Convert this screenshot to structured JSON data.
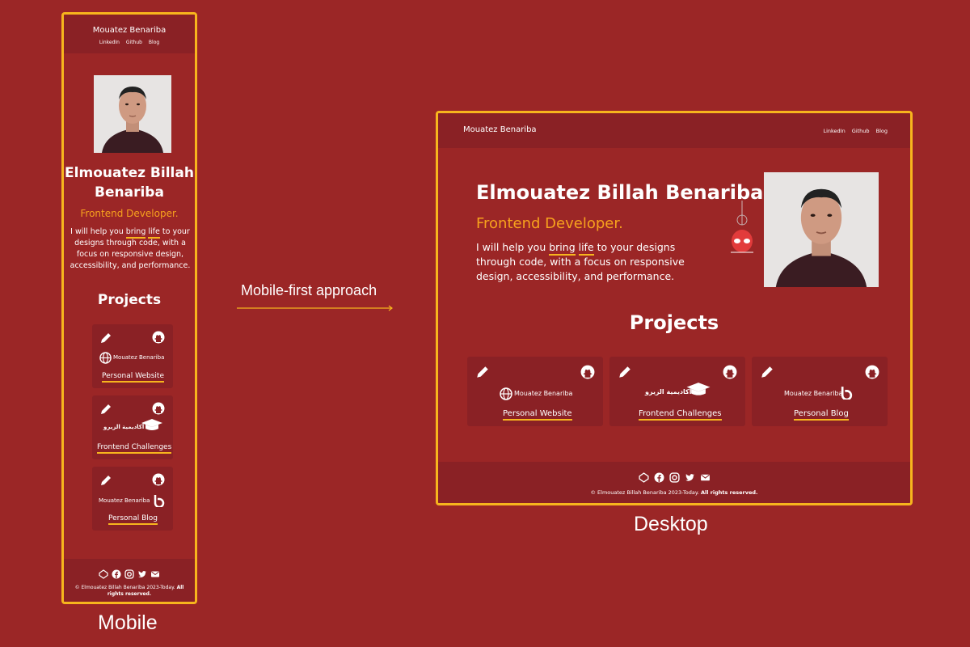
{
  "site": {
    "brand": "Mouatez Benariba",
    "nav": [
      "LinkedIn",
      "Github",
      "Blog"
    ]
  },
  "hero": {
    "name": "Elmouatez Billah Benariba",
    "name_line1": "Elmouatez Billah",
    "name_line2": "Benariba",
    "role": "Frontend Developer.",
    "intro_pre": "I will help you ",
    "intro_bring": "bring",
    "intro_life": "life",
    "intro_post": " to your designs through code, with a focus on responsive design, accessibility, and performance."
  },
  "projects": {
    "heading": "Projects",
    "items": [
      {
        "logo_text": "Mouatez Benariba",
        "link": "Personal Website"
      },
      {
        "logo_text": "أكاديمية الزيرو",
        "link": "Frontend Challenges"
      },
      {
        "logo_text": "Mouatez Benariba",
        "link": "Personal Blog"
      }
    ]
  },
  "footer": {
    "copyright": "© Elmouatez Billah Benariba 2023-Today.",
    "rights": "All rights reserved."
  },
  "labels": {
    "mobile": "Mobile",
    "desktop": "Desktop",
    "approach": "Mobile-first approach"
  },
  "colors": {
    "background": "#9b2626",
    "frame": "#f7b51d",
    "accent": "#f7a21d",
    "card": "#8a2125"
  }
}
